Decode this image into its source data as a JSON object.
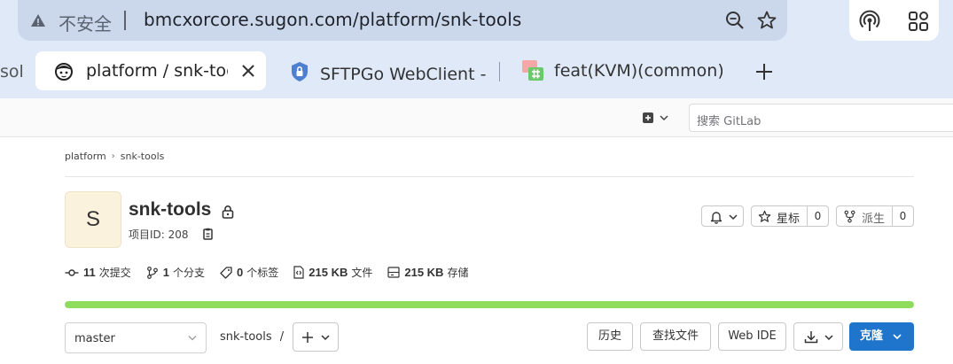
{
  "browser": {
    "security_label": "不安全",
    "url": "bmcxorcore.sugon.com/platform/snk-tools",
    "tabs": [
      {
        "label": "sol"
      },
      {
        "label": "platform / snk-tools"
      },
      {
        "label": "SFTPGo WebClient - 文件"
      },
      {
        "label": "feat(KVM)(common): add"
      }
    ]
  },
  "header": {
    "search_placeholder": "搜索 GitLab"
  },
  "breadcrumb": [
    "platform",
    "snk-tools"
  ],
  "project": {
    "avatar_letter": "S",
    "name": "snk-tools",
    "id_text": "项目ID: 208",
    "star_label": "星标",
    "star_count": "0",
    "fork_label": "派生",
    "fork_count": "0"
  },
  "stats": [
    {
      "count": "11",
      "label": "次提交",
      "icon": "commit-icon"
    },
    {
      "count": "1",
      "label": "个分支",
      "icon": "branch-icon"
    },
    {
      "count": "0",
      "label": "个标签",
      "icon": "tag-icon"
    },
    {
      "count": "215 KB",
      "label": "文件",
      "icon": "file-icon"
    },
    {
      "count": "215 KB",
      "label": "存储",
      "icon": "storage-icon"
    }
  ],
  "language_bar": {
    "fill_fraction": 1.0,
    "color": "#8fdc5d"
  },
  "repo": {
    "branch": "master",
    "path": "snk-tools",
    "path_sep": "/",
    "history": "历史",
    "find_file": "查找文件",
    "web_ide": "Web IDE",
    "clone": "克隆"
  },
  "colors": {
    "accent": "#1f75cb",
    "chrome": "#dfe9f8"
  }
}
